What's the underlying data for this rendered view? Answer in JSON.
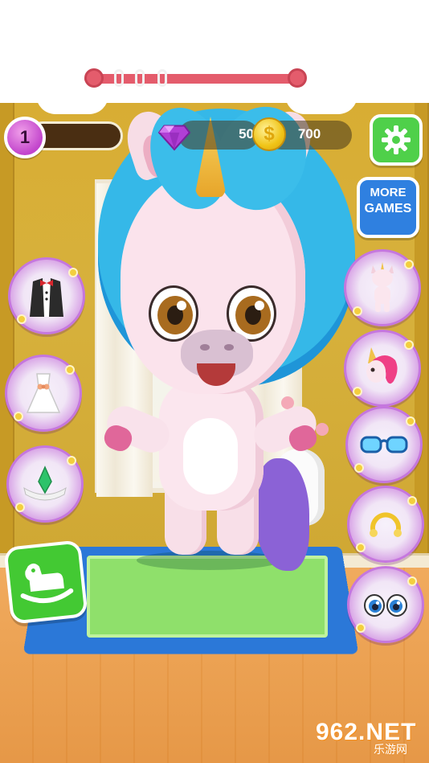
{
  "hud": {
    "level": "1",
    "gems": "50",
    "coins": "700",
    "coin_glyph": "$"
  },
  "buttons": {
    "more_games_line1": "MORE",
    "more_games_line2": "GAMES"
  },
  "left_categories": [
    {
      "name": "tuxedo-outfit",
      "icon": "tuxedo-icon"
    },
    {
      "name": "dress-outfit",
      "icon": "dress-icon"
    },
    {
      "name": "tiara-accessory",
      "icon": "tiara-icon"
    }
  ],
  "right_categories": [
    {
      "name": "body-color",
      "icon": "unicorn-body-icon"
    },
    {
      "name": "mane-style",
      "icon": "unicorn-mane-icon"
    },
    {
      "name": "glasses",
      "icon": "glasses-icon"
    },
    {
      "name": "nose-ring",
      "icon": "nose-ring-icon"
    },
    {
      "name": "eyes",
      "icon": "eyes-icon"
    }
  ],
  "watermark": {
    "main": "962.NET",
    "sub": "乐游网"
  },
  "colors": {
    "wall": "#d7b13c",
    "floor": "#f0a655",
    "mane": "#35b8e8",
    "accent_purple": "#c245cc",
    "button_green": "#4fd04a",
    "button_blue": "#2f80e0"
  }
}
